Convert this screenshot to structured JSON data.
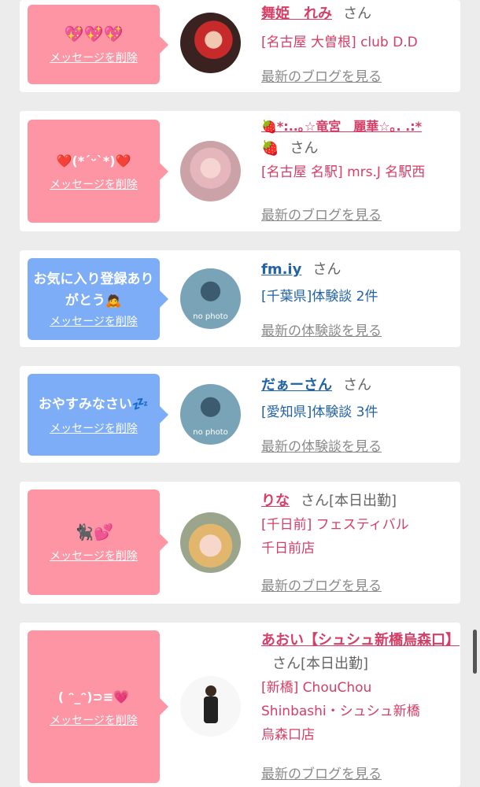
{
  "cards": [
    {
      "message": "💖💖💖",
      "delete_label": "メッセージを削除",
      "name": "舞姫　れみ",
      "san": "さん",
      "status": "",
      "lines": [
        "[名古屋 大曽根] club D.D"
      ],
      "link": "最新のブログを見る"
    },
    {
      "message": "❤️(*´ᵕ`*)❤️",
      "delete_label": "メッセージを削除",
      "name": "🍓*:..｡☆竜宮　麗華☆｡. .:*",
      "name2": "🍓",
      "san": "さん",
      "status": "",
      "lines": [
        "[名古屋 名駅] mrs.J 名駅西"
      ],
      "link": "最新のブログを見る"
    },
    {
      "message": "お気に入り登録ありがとう🙇",
      "delete_label": "メッセージを削除",
      "name": "fm.iy",
      "san": "さん",
      "status": "",
      "lines": [
        "[千葉県]体験談 2件"
      ],
      "link": "最新の体験談を見る",
      "no_photo": "no photo"
    },
    {
      "message": "おやすみなさい💤",
      "delete_label": "メッセージを削除",
      "name": "だぁーさん",
      "san": "さん",
      "status": "",
      "lines": [
        "[愛知県]体験談 3件"
      ],
      "link": "最新の体験談を見る",
      "no_photo": "no photo"
    },
    {
      "message": "🐈‍⬛💕",
      "delete_label": "メッセージを削除",
      "name": "りな",
      "san": "さん",
      "status": "[本日出勤]",
      "lines": [
        "[千日前] フェスティバル",
        "千日前店"
      ],
      "link": "最新のブログを見る"
    },
    {
      "message": "( ᵔ_ᵔ)⊃≡💗",
      "delete_label": "メッセージを削除",
      "name": "あおい【シュシュ新橋烏森口】",
      "san": "さん",
      "status": "[本日出勤]",
      "lines": [
        "[新橋] ChouChou",
        "Shinbashi・シュシュ新橋",
        "烏森口店"
      ],
      "link": "最新のブログを見る"
    }
  ]
}
